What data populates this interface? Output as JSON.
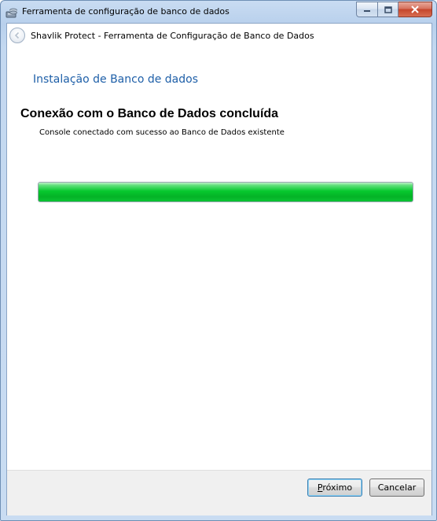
{
  "window": {
    "title": "Ferramenta de configuração de banco de dados"
  },
  "nav": {
    "title": "Shavlik Protect - Ferramenta de Configuração de Banco de Dados"
  },
  "content": {
    "section_heading": "Instalação de Banco de dados",
    "main_heading": "Conexão com o Banco de Dados concluída",
    "status_text": "Console conectado com sucesso ao Banco de Dados existente",
    "progress": 1.0
  },
  "footer": {
    "next_label": "Próximo",
    "cancel_label": "Cancelar"
  },
  "colors": {
    "progress_green": "#06c82e",
    "heading_blue": "#1e5fa8",
    "close_red": "#c5452c"
  },
  "icons": {
    "app": "database-tool-icon",
    "back": "back-arrow-icon",
    "minimize": "minimize-icon",
    "maximize": "maximize-icon",
    "close": "close-icon"
  }
}
